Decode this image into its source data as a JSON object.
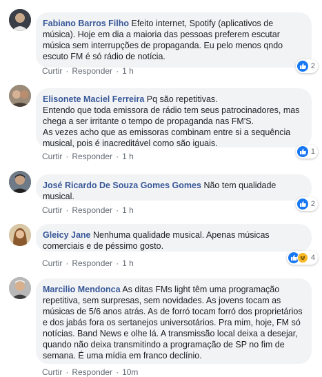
{
  "actions": {
    "like": "Curtir",
    "reply": "Responder",
    "separator": "·"
  },
  "colors": {
    "author": "#385898",
    "bubble": "#f2f3f5",
    "like": "#1877f2",
    "meta": "#606770"
  },
  "comments": [
    {
      "author": "Fabiano Barros Filho",
      "text": "Efeito internet, Spotify (aplicativos de música). Hoje em dia a maioria das pessoas preferem escutar música sem interrupções de propaganda. Eu pelo menos qndo escuto FM é só rádio de notícia.",
      "time": "1 h",
      "reaction_count": "2",
      "reactions": [
        "like"
      ]
    },
    {
      "author": "Elisonete Maciel Ferreira",
      "text": "Pq são repetitivas.",
      "text2": "Entendo que toda emissora de rádio tem seus patrocinadores, mas chega a ser irritante o tempo de propaganda nas FM'S.",
      "text3": "As vezes acho que as emissoras combinam entre si a sequência musical, pois é inacreditável como são iguais.",
      "time": "1 h",
      "reaction_count": "1",
      "reactions": [
        "like"
      ]
    },
    {
      "author": "José Ricardo De Souza Gomes Gomes",
      "text": "Não tem qualidade musical.",
      "time": "1 h",
      "reaction_count": "2",
      "reactions": [
        "like"
      ]
    },
    {
      "author": "Gleicy Jane",
      "text": "Nenhuma qualidade musical. Apenas músicas comerciais e de péssimo gosto.",
      "time": "1 h",
      "reaction_count": "4",
      "reactions": [
        "like",
        "haha"
      ]
    },
    {
      "author": "Marcilio Mendonca",
      "text": "As ditas FMs light têm uma programação repetitiva, sem surpresas, sem novidades. As jovens tocam as músicas de 5/6 anos atrás. As de forró tocam forró dos proprietários e dos jabás fora os sertanejos universotários. Pra mim, hoje, FM só notícias. Band News e olhe lá. A transmissão local deixa a desejar, quando não deixa transmitindo a programação de SP no fim de semana. É uma mídia em franco declínio.",
      "time": "10m",
      "reaction_count": "",
      "reactions": []
    }
  ]
}
